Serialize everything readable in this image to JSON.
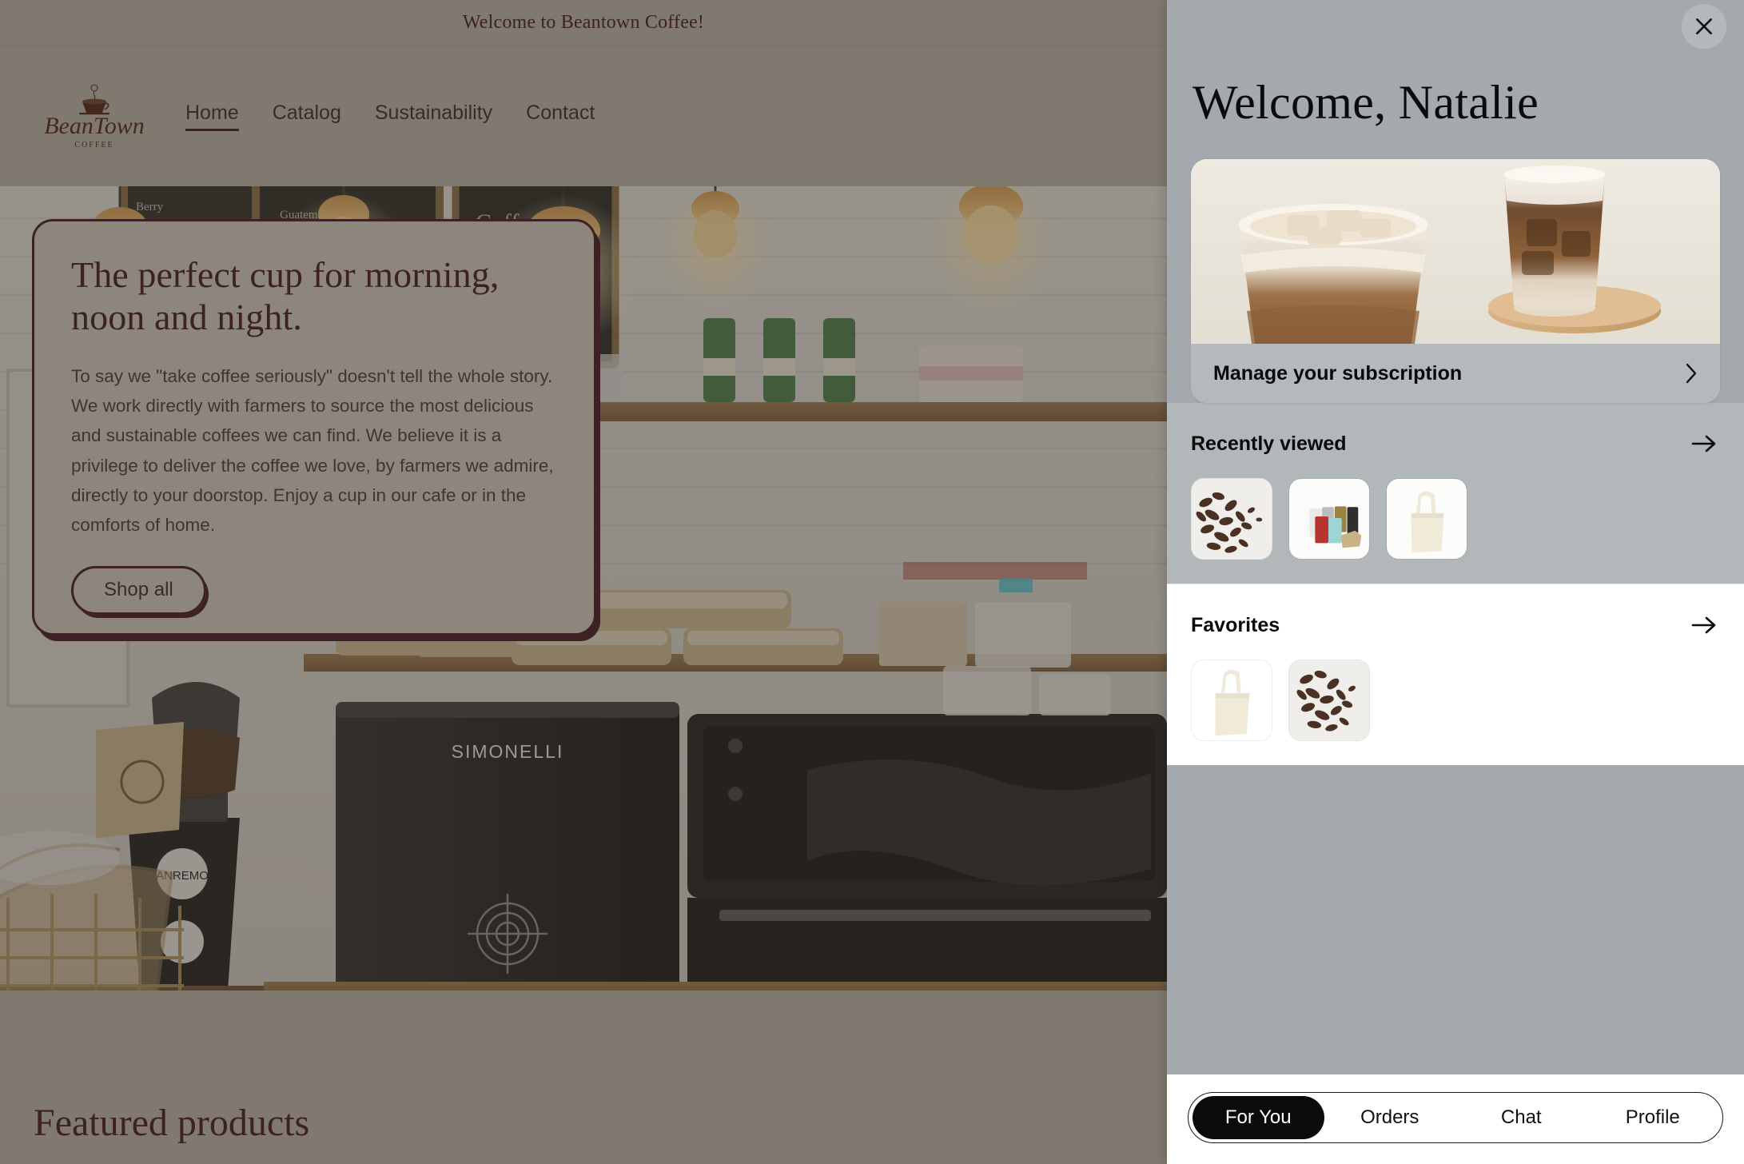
{
  "store": {
    "announcement": "Welcome to Beantown Coffee!",
    "logo": {
      "word": "BeanTown",
      "sub": "COFFEE",
      "icon": "coffee-cup-icon"
    },
    "nav": [
      {
        "label": "Home",
        "active": true
      },
      {
        "label": "Catalog",
        "active": false
      },
      {
        "label": "Sustainability",
        "active": false
      },
      {
        "label": "Contact",
        "active": false
      }
    ],
    "hero": {
      "title": "The perfect cup for morning, noon and night.",
      "body": "To say we \"take coffee seriously\" doesn't tell the whole story. We work directly with farmers to source the most delicious and sustainable coffees we can find. We believe it is a privilege to deliver the coffee we love, by farmers we admire, directly to your doorstop. Enjoy a cup in our cafe or in the comforts of home.",
      "cta": "Shop all"
    },
    "featured_title": "Featured products"
  },
  "panel": {
    "close_icon": "close-icon",
    "greeting": "Welcome, Natalie",
    "subscription": {
      "label": "Manage your subscription",
      "chevron_icon": "chevron-right-icon",
      "image_alt": "iced-coffee-drinks-photo"
    },
    "recently_viewed": {
      "title": "Recently viewed",
      "arrow_icon": "arrow-right-icon",
      "items": [
        {
          "name": "cocoa-nibs-thumbnail"
        },
        {
          "name": "coffee-bags-thumbnail"
        },
        {
          "name": "tote-bag-thumbnail"
        }
      ]
    },
    "favorites": {
      "title": "Favorites",
      "arrow_icon": "arrow-right-icon",
      "items": [
        {
          "name": "tote-bag-thumbnail"
        },
        {
          "name": "cocoa-nibs-thumbnail"
        }
      ]
    },
    "tabs": [
      {
        "label": "For You",
        "active": true
      },
      {
        "label": "Orders",
        "active": false
      },
      {
        "label": "Chat",
        "active": false
      },
      {
        "label": "Profile",
        "active": false
      }
    ]
  },
  "colors": {
    "brand_dark": "#3d0f1c",
    "panel_bg": "#a4a9ad",
    "tab_active_bg": "#0b0b0b",
    "hero_card_bg": "#cfc9bf"
  }
}
